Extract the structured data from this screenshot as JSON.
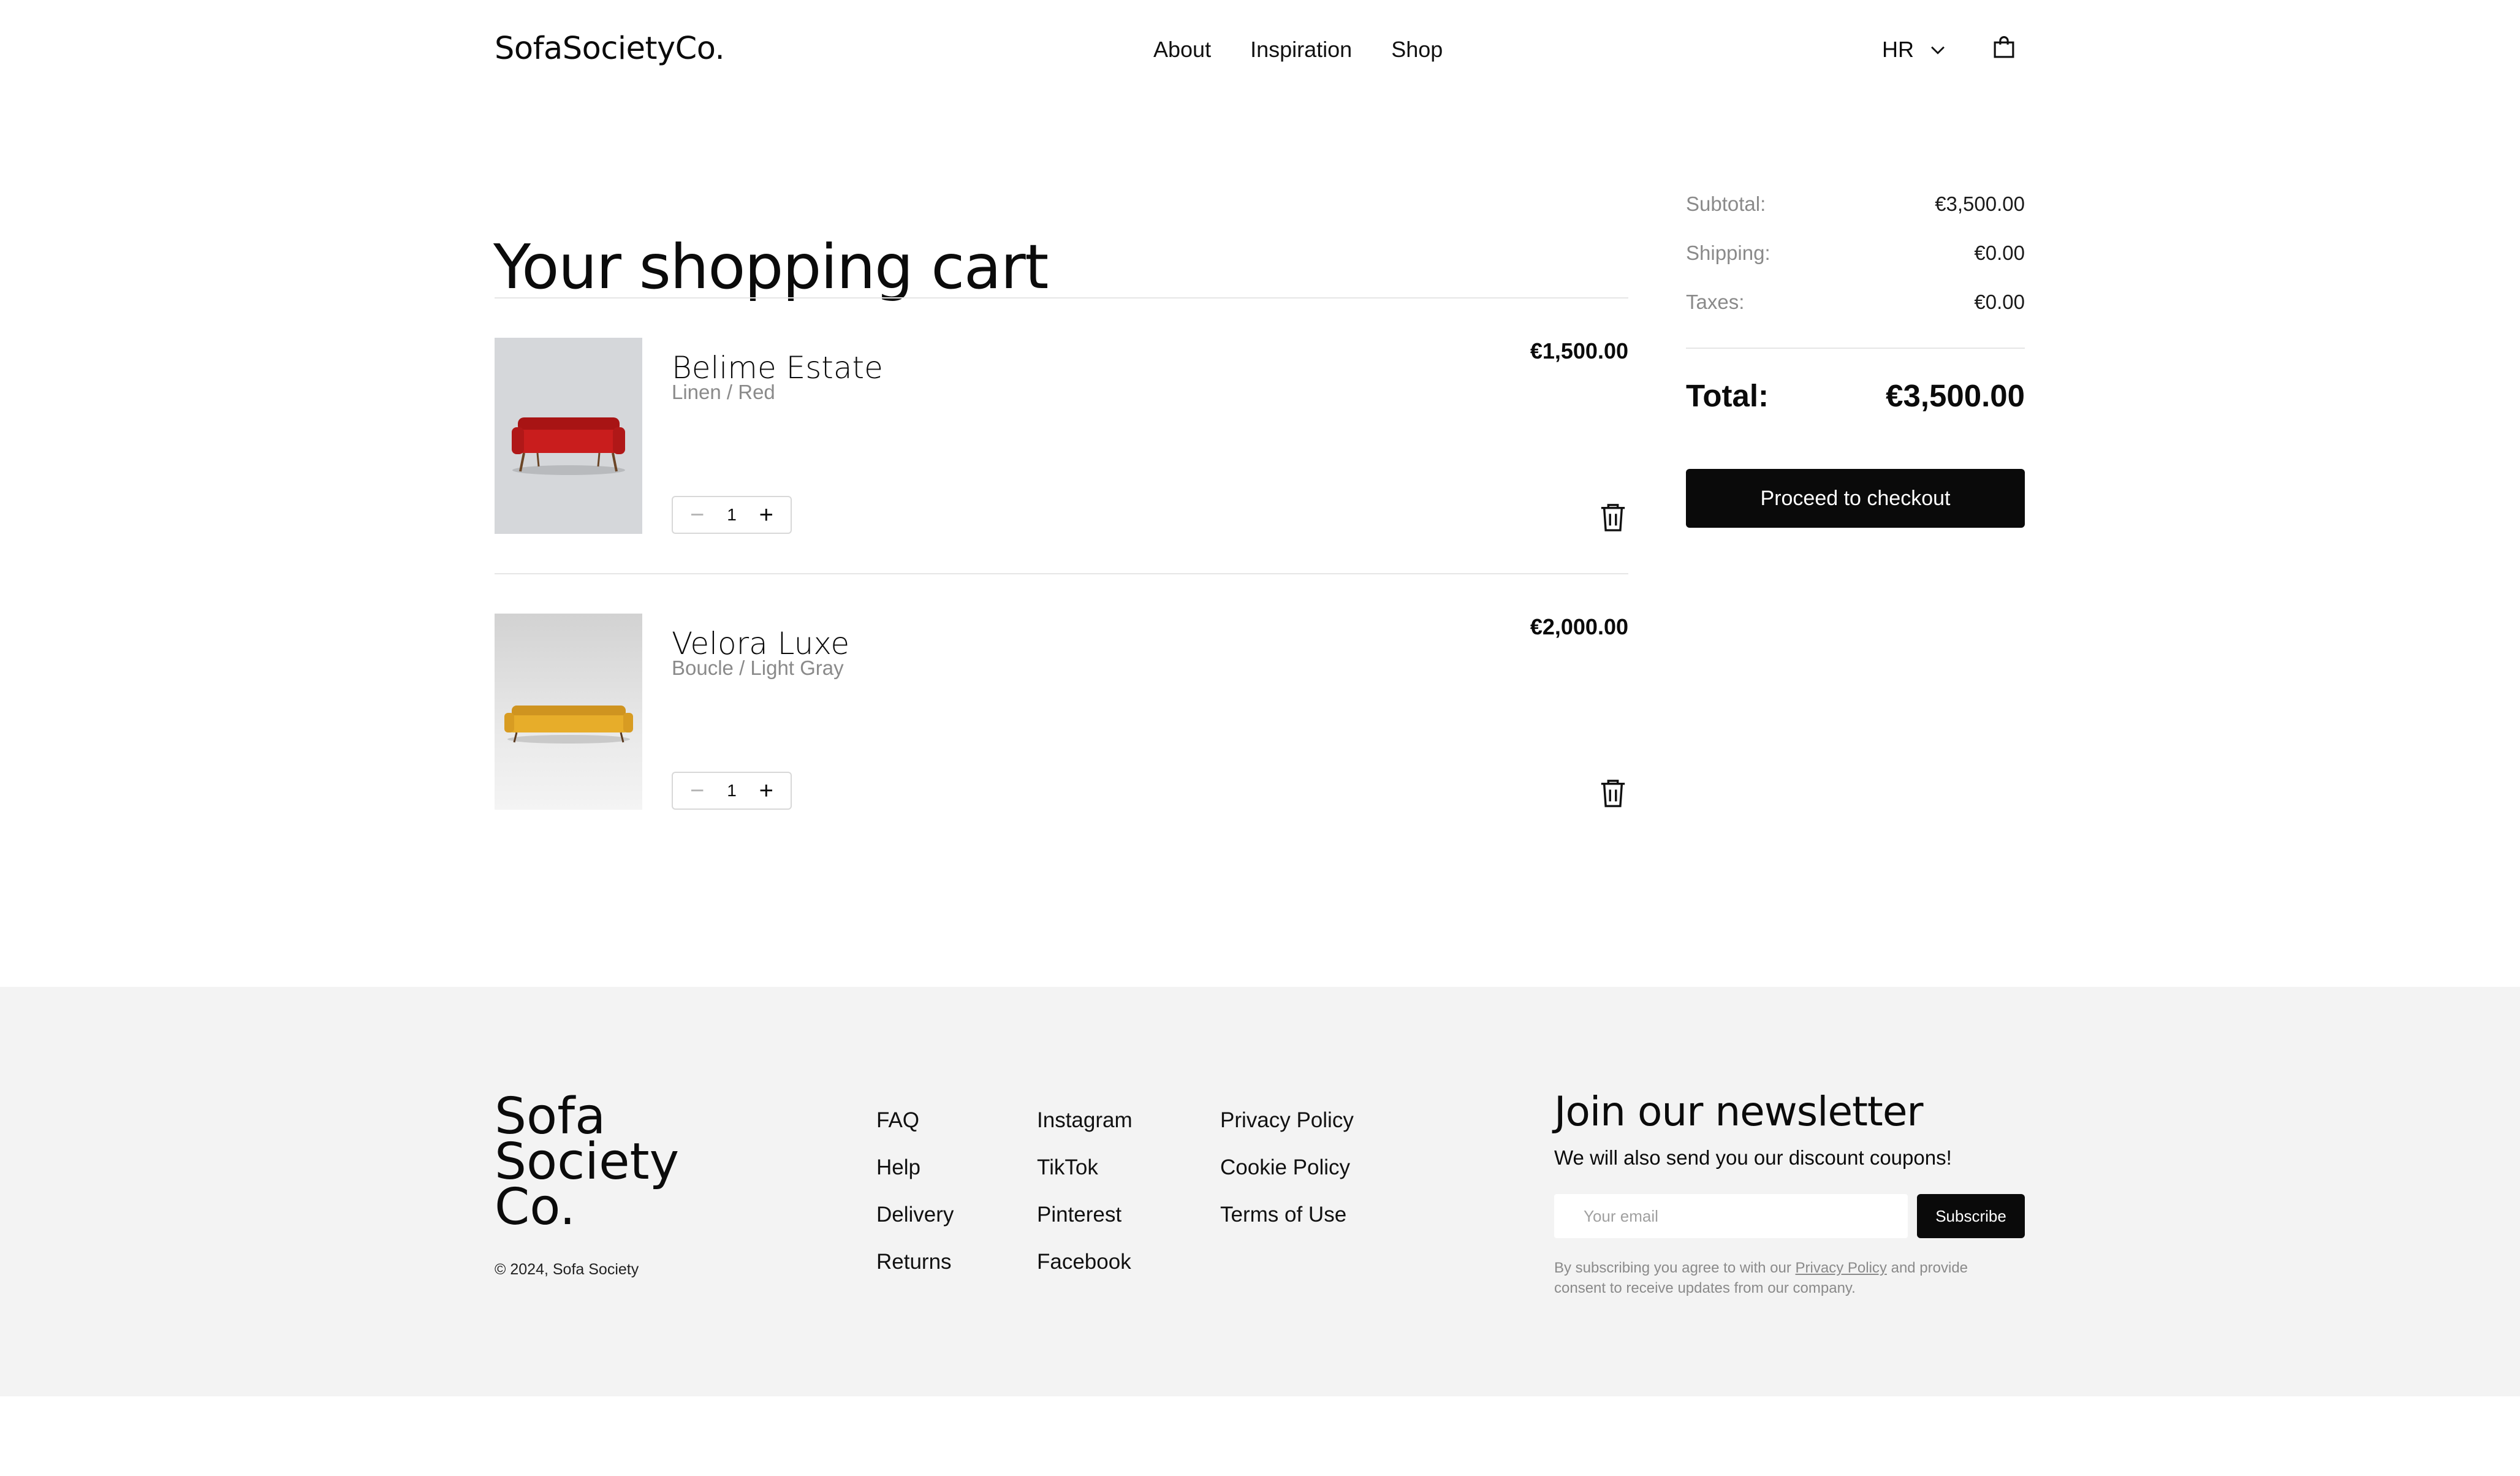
{
  "header": {
    "logo": "SofaSocietyCo.",
    "nav": [
      "About",
      "Inspiration",
      "Shop"
    ],
    "region": "HR",
    "icons": {
      "region": "chevron-down-icon",
      "cart": "shopping-bag-icon"
    }
  },
  "cart": {
    "title": "Your shopping cart",
    "items": [
      {
        "name": "Belime Estate",
        "variant": "Linen / Red",
        "price": "€1,500.00",
        "quantity": "1",
        "sofa_color": "#c91d1d",
        "bg_color": "#d5d7da"
      },
      {
        "name": "Velora Luxe",
        "variant": "Boucle / Light Gray",
        "price": "€2,000.00",
        "quantity": "1",
        "sofa_color": "#e7ad2a",
        "bg_color": "#e6e6e6"
      }
    ],
    "qty_minus": "−",
    "qty_plus": "+"
  },
  "summary": {
    "subtotal_label": "Subtotal:",
    "subtotal": "€3,500.00",
    "shipping_label": "Shipping:",
    "shipping": "€0.00",
    "taxes_label": "Taxes:",
    "taxes": "€0.00",
    "total_label": "Total:",
    "total": "€3,500.00",
    "checkout_label": "Proceed to checkout"
  },
  "footer": {
    "logo_lines": [
      "Sofa",
      "Society",
      "Co."
    ],
    "copyright": "© 2024, Sofa Society",
    "col1": [
      "FAQ",
      "Help",
      "Delivery",
      "Returns"
    ],
    "col2": [
      "Instagram",
      "TikTok",
      "Pinterest",
      "Facebook"
    ],
    "col3": [
      "Privacy Policy",
      "Cookie Policy",
      "Terms of Use"
    ],
    "newsletter": {
      "title": "Join our newsletter",
      "subtitle": "We will also send you our discount coupons!",
      "placeholder": "Your email",
      "button": "Subscribe",
      "note_before": "By subscribing you agree to with our ",
      "note_link": "Privacy Policy",
      "note_after": " and provide consent to receive updates from our company."
    }
  },
  "colors": {
    "accent": "#0a0a0a",
    "footer_bg": "#f3f3f3",
    "muted": "#8a8a8a"
  }
}
